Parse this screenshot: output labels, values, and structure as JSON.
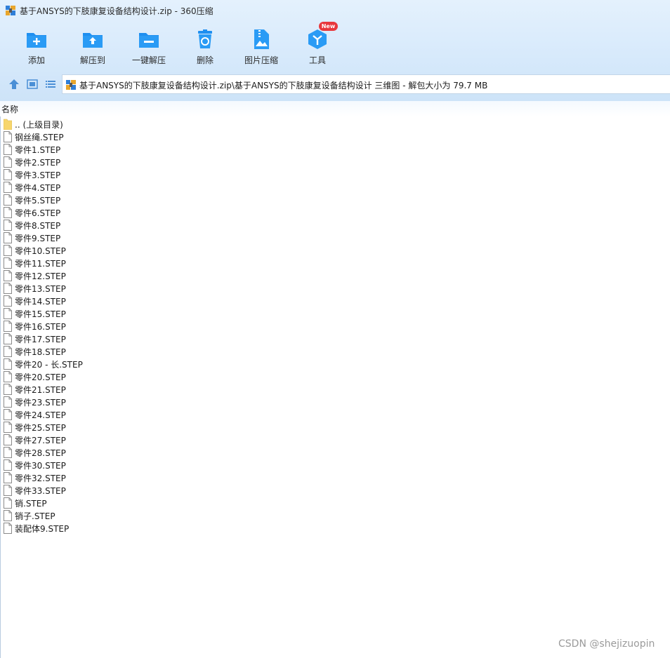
{
  "window": {
    "title": "基于ANSYS的下肢康复设备结构设计.zip - 360压缩"
  },
  "toolbar": {
    "add": "添加",
    "extract_to": "解压到",
    "one_click_extract": "一键解压",
    "delete": "删除",
    "image_compress": "图片压缩",
    "tools": "工具",
    "new_badge": "New"
  },
  "address": {
    "path": "基于ANSYS的下肢康复设备结构设计.zip\\基于ANSYS的下肢康复设备结构设计 三维图 - 解包大小为 79.7 MB"
  },
  "list": {
    "column_name": "名称",
    "parent": ".. (上级目录)",
    "files": [
      "钢丝绳.STEP",
      "零件1.STEP",
      "零件2.STEP",
      "零件3.STEP",
      "零件4.STEP",
      "零件5.STEP",
      "零件6.STEP",
      "零件8.STEP",
      "零件9.STEP",
      "零件10.STEP",
      "零件11.STEP",
      "零件12.STEP",
      "零件13.STEP",
      "零件14.STEP",
      "零件15.STEP",
      "零件16.STEP",
      "零件17.STEP",
      "零件18.STEP",
      "零件20 - 长.STEP",
      "零件20.STEP",
      "零件21.STEP",
      "零件23.STEP",
      "零件24.STEP",
      "零件25.STEP",
      "零件27.STEP",
      "零件28.STEP",
      "零件30.STEP",
      "零件32.STEP",
      "零件33.STEP",
      "销.STEP",
      "销子.STEP",
      "装配体9.STEP"
    ]
  },
  "watermark": "CSDN @shejizuopin",
  "colors": {
    "icon_blue": "#1e8ff0",
    "badge_red": "#e8383d",
    "folder_yellow": "#f7d66d"
  }
}
